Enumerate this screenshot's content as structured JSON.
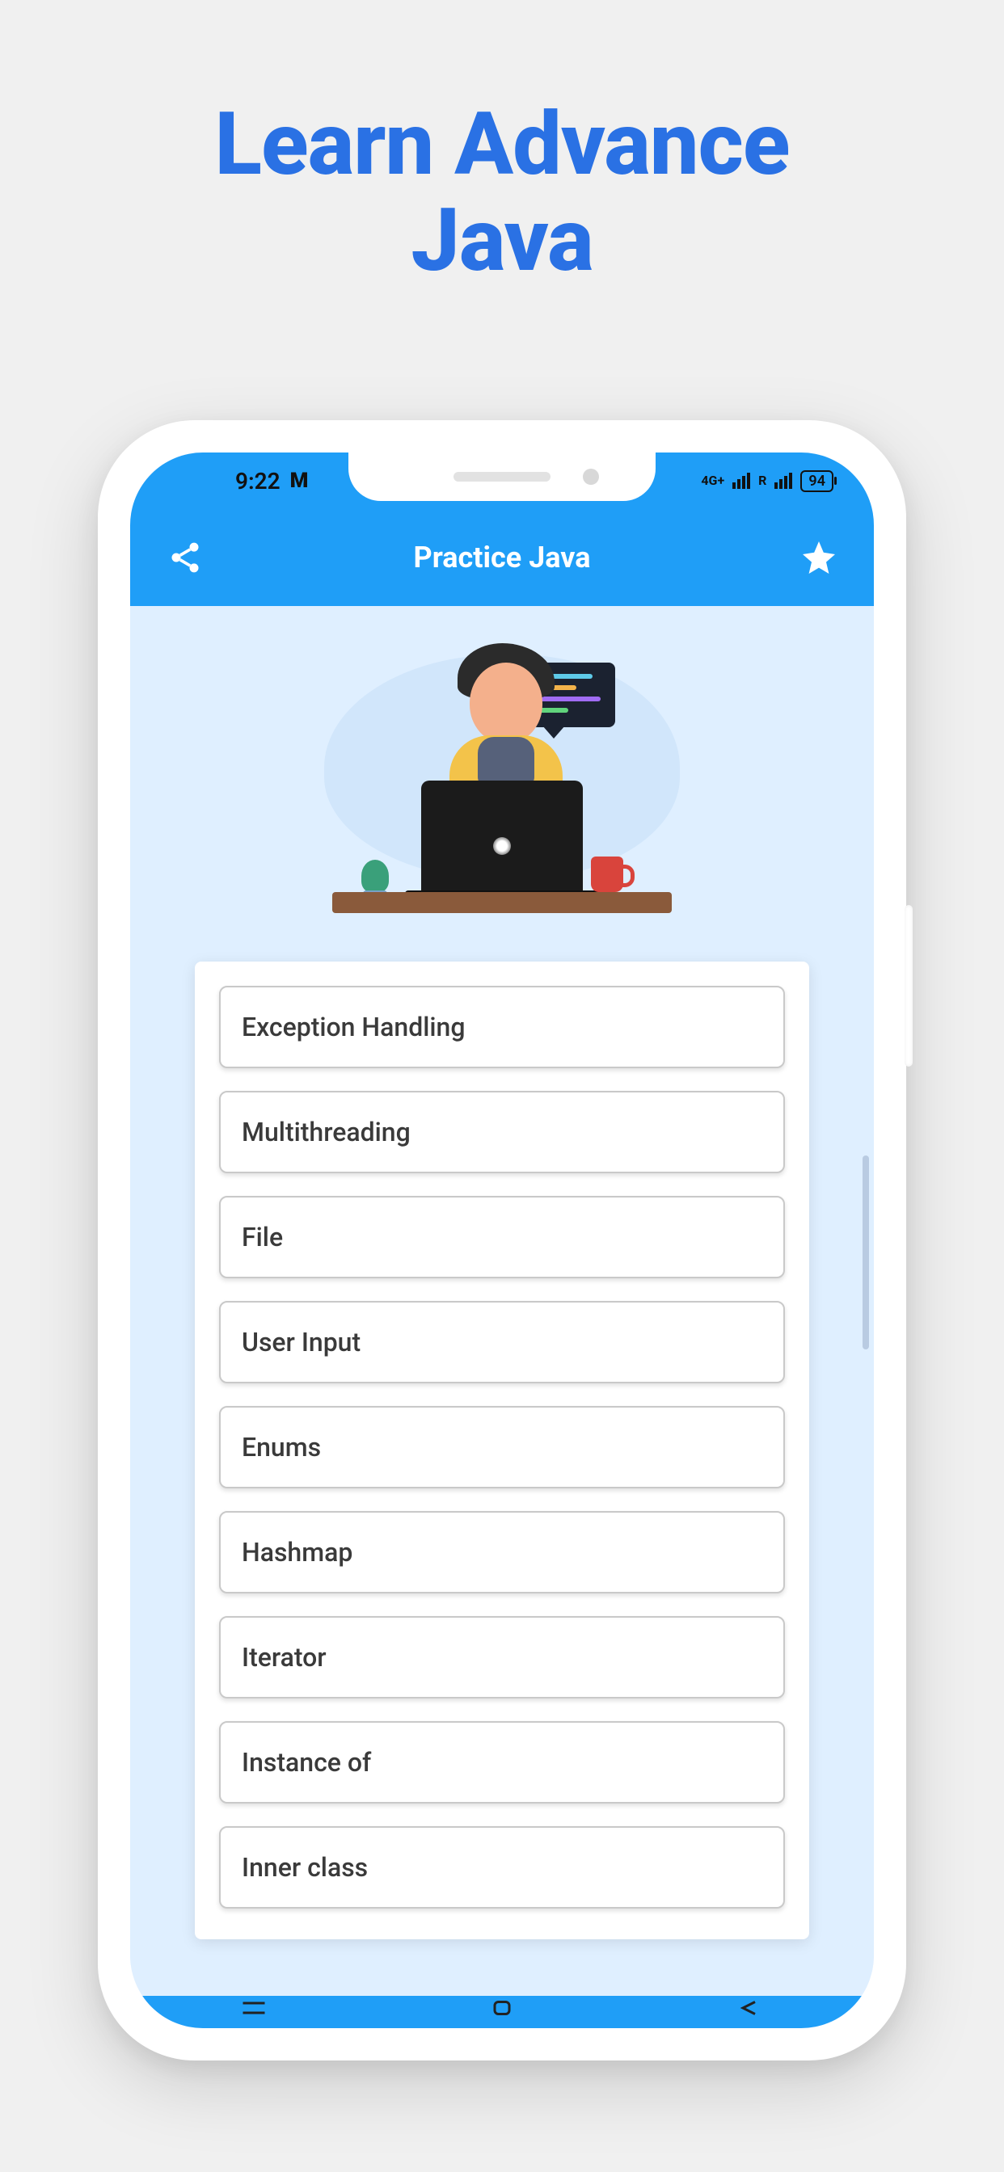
{
  "promo": {
    "title_line1": "Learn Advance",
    "title_line2": "Java"
  },
  "status": {
    "time": "9:22",
    "m_label": "M",
    "net1": "4G+",
    "net2": "R",
    "battery": "94"
  },
  "app_bar": {
    "title": "Practice Java"
  },
  "topics": [
    "Exception Handling",
    "Multithreading",
    "File",
    "User Input",
    "Enums",
    "Hashmap",
    "Iterator",
    "Instance of",
    "Inner class"
  ]
}
